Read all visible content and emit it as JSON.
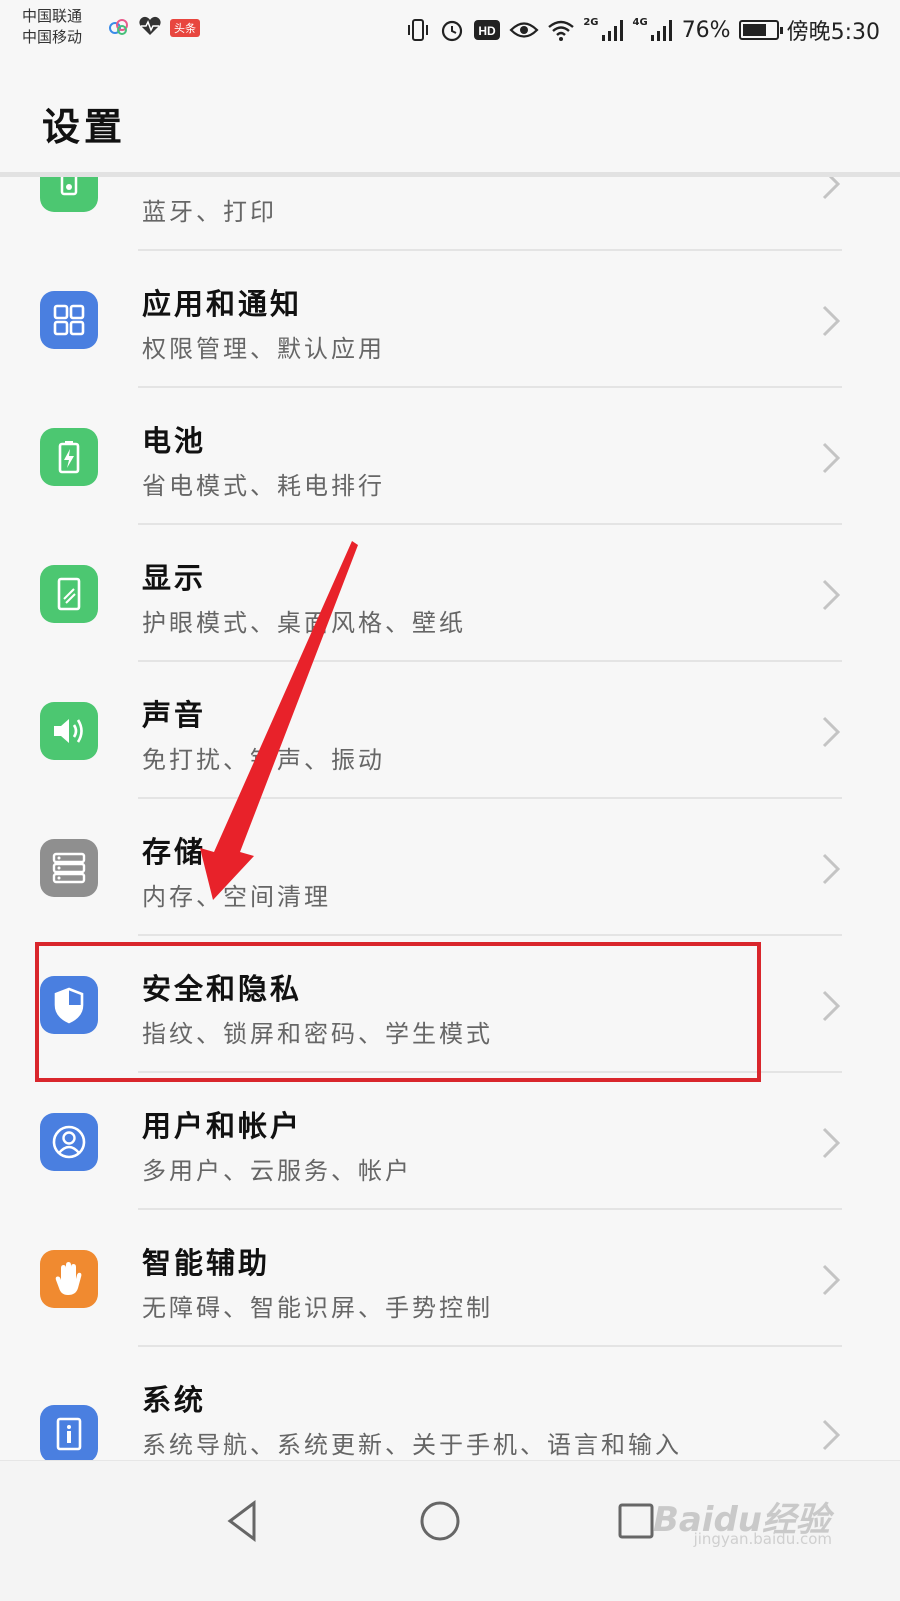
{
  "status_bar": {
    "carrier_1": "中国联通",
    "carrier_2": "中国移动",
    "app_badge": "头条",
    "net_2g": "2G",
    "net_4g": "4G",
    "battery_percent": "76%",
    "battery_level": 0.76,
    "time": "傍晚5:30",
    "icons": [
      "cloud-icon",
      "heart-icon",
      "vibrate-icon",
      "alarm-icon",
      "hd-icon",
      "eye-icon",
      "wifi-icon",
      "signal-icon",
      "battery-icon"
    ]
  },
  "header": {
    "title": "设置"
  },
  "settings": [
    {
      "name": "device-connection",
      "title": "",
      "subtitle": "蓝牙、打印",
      "icon": "device-connection-icon",
      "color": "#4cc771"
    },
    {
      "name": "apps-notifications",
      "title": "应用和通知",
      "subtitle": "权限管理、默认应用",
      "icon": "apps-grid-icon",
      "color": "#4a7fe0"
    },
    {
      "name": "battery",
      "title": "电池",
      "subtitle": "省电模式、耗电排行",
      "icon": "battery-icon",
      "color": "#4cc771"
    },
    {
      "name": "display",
      "title": "显示",
      "subtitle": "护眼模式、桌面风格、壁纸",
      "icon": "display-icon",
      "color": "#4cc771"
    },
    {
      "name": "sound",
      "title": "声音",
      "subtitle": "免打扰、铃声、振动",
      "icon": "speaker-icon",
      "color": "#4cc771"
    },
    {
      "name": "storage",
      "title": "存储",
      "subtitle": "内存、空间清理",
      "icon": "storage-icon",
      "color": "#8f8f8f"
    },
    {
      "name": "security-privacy",
      "title": "安全和隐私",
      "subtitle": "指纹、锁屏和密码、学生模式",
      "icon": "shield-icon",
      "color": "#4a7fe0"
    },
    {
      "name": "users-accounts",
      "title": "用户和帐户",
      "subtitle": "多用户、云服务、帐户",
      "icon": "user-icon",
      "color": "#4a7fe0"
    },
    {
      "name": "smart-assistance",
      "title": "智能辅助",
      "subtitle": "无障碍、智能识屏、手势控制",
      "icon": "hand-icon",
      "color": "#f08a30"
    },
    {
      "name": "system",
      "title": "系统",
      "subtitle": "系统导航、系统更新、关于手机、语言和输入",
      "icon": "info-icon",
      "color": "#4a7fe0"
    }
  ],
  "nav_bar": {
    "buttons": [
      "back-icon",
      "home-icon",
      "recents-icon"
    ]
  },
  "watermark": {
    "brand": "Baidu经验",
    "url": "jingyan.baidu.com"
  },
  "colors": {
    "highlight": "#d9262c",
    "background": "#f7f7f7"
  }
}
